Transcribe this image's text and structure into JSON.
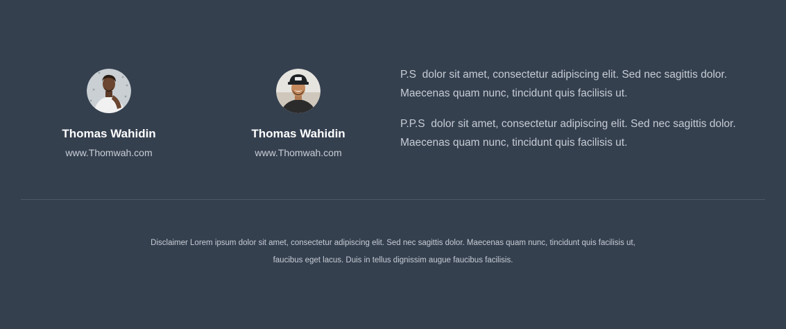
{
  "authors": [
    {
      "name": "Thomas Wahidin",
      "website": "www.Thomwah.com"
    },
    {
      "name": "Thomas Wahidin",
      "website": "www.Thomwah.com"
    }
  ],
  "postscripts": [
    "P.S  dolor sit amet, consectetur adipiscing elit. Sed nec sagittis dolor. Maecenas quam nunc, tincidunt quis facilisis ut.",
    "P.P.S  dolor sit amet, consectetur adipiscing elit. Sed nec sagittis dolor. Maecenas quam nunc, tincidunt quis facilisis ut."
  ],
  "footer": {
    "disclaimer_line1": "Disclaimer Lorem ipsum dolor sit amet, consectetur adipiscing elit. Sed nec sagittis dolor. Maecenas quam nunc, tincidunt quis facilisis ut,",
    "disclaimer_line2": "faucibus eget lacus. Duis in tellus dignissim augue faucibus facilisis."
  },
  "colors": {
    "background": "#35404f",
    "text_primary": "#ffffff",
    "text_secondary": "#c6ccd5",
    "divider": "#4e5968"
  }
}
